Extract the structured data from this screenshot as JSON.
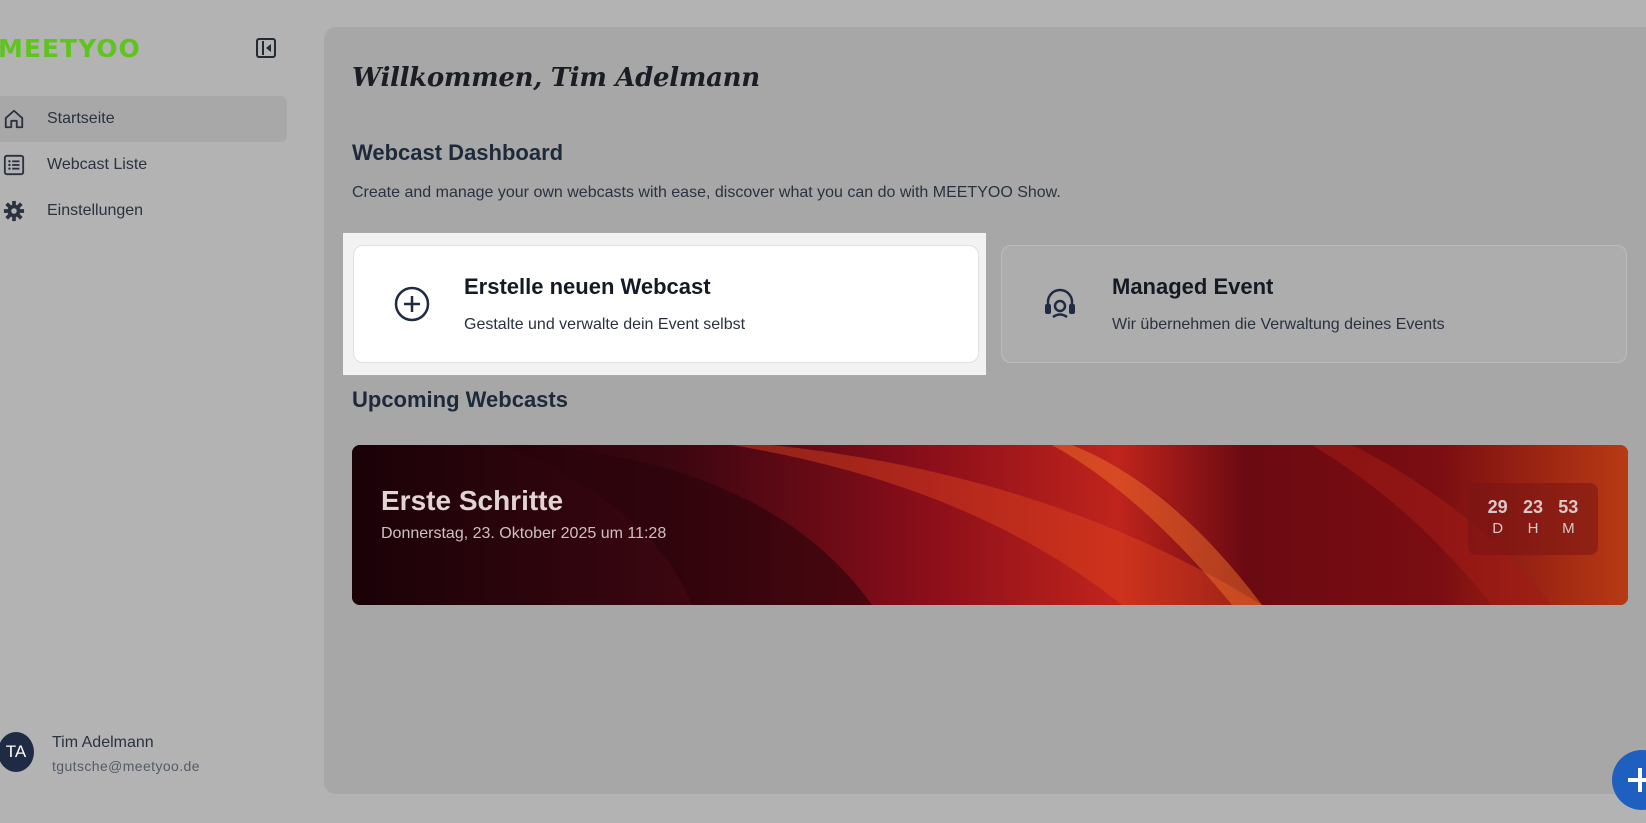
{
  "brand": {
    "logo_text": "MEETYOO",
    "logo_color": "#5fc41e"
  },
  "sidebar": {
    "collapse_icon": "sidebar-collapse-icon",
    "items": [
      {
        "label": "Startseite",
        "icon": "home-icon",
        "active": true
      },
      {
        "label": "Webcast Liste",
        "icon": "list-icon",
        "active": false
      },
      {
        "label": "Einstellungen",
        "icon": "gear-icon",
        "active": false
      }
    ],
    "user": {
      "initials": "TA",
      "name": "Tim Adelmann",
      "email": "tgutsche@meetyoo.de"
    }
  },
  "main": {
    "welcome": "Willkommen, Tim Adelmann",
    "dashboard_title": "Webcast Dashboard",
    "dashboard_desc": "Create and manage your own webcasts with ease, discover what you can do with MEETYOO Show.",
    "cards": [
      {
        "title": "Erstelle neuen Webcast",
        "desc": "Gestalte und verwalte dein Event selbst",
        "icon": "plus-circle-icon"
      },
      {
        "title": "Managed Event",
        "desc": "Wir übernehmen die Verwaltung deines Events",
        "icon": "headset-icon"
      }
    ],
    "upcoming_title": "Upcoming Webcasts",
    "upcoming": {
      "title": "Erste Schritte",
      "date": "Donnerstag, 23. Oktober 2025 um 11:28",
      "countdown": [
        {
          "value": "29",
          "unit": "D"
        },
        {
          "value": "23",
          "unit": "H"
        },
        {
          "value": "53",
          "unit": "M"
        }
      ]
    }
  },
  "fab": {
    "icon": "chat-support-icon",
    "color": "#1f5fbf"
  }
}
